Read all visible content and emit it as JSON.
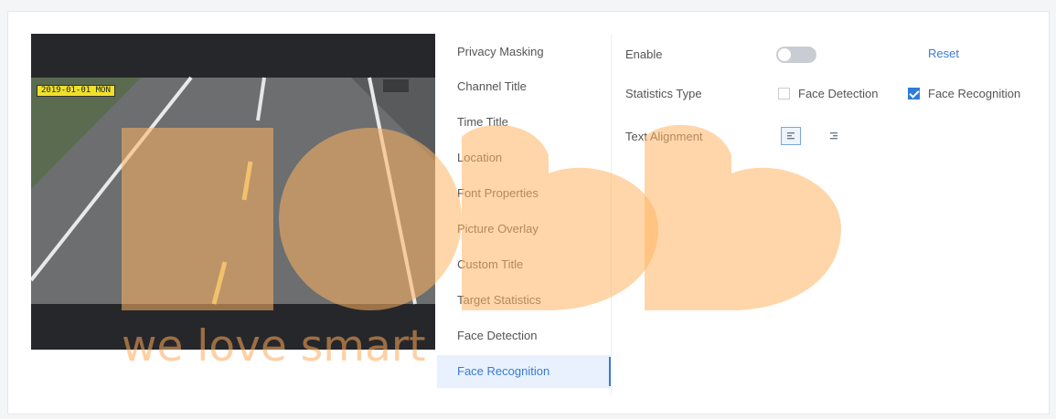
{
  "preview": {
    "osd_label": "2019-01-01 MON"
  },
  "menu": {
    "items": [
      {
        "label": "Privacy Masking"
      },
      {
        "label": "Channel Title"
      },
      {
        "label": "Time Title"
      },
      {
        "label": "Location"
      },
      {
        "label": "Font Properties"
      },
      {
        "label": "Picture Overlay"
      },
      {
        "label": "Custom Title"
      },
      {
        "label": "Target Statistics"
      },
      {
        "label": "Face Detection"
      },
      {
        "label": "Face Recognition"
      }
    ],
    "active": "Face Recognition"
  },
  "settings": {
    "enable_label": "Enable",
    "enable_state": "off",
    "reset_label": "Reset",
    "statistics_type_label": "Statistics Type",
    "face_detection_label": "Face Detection",
    "face_detection_checked": false,
    "face_recognition_label": "Face Recognition",
    "face_recognition_checked": true,
    "text_alignment_label": "Text Alignment",
    "align_left_icon": "align-left-icon",
    "align_right_icon": "align-right-icon"
  },
  "watermark": {
    "text": "we love smart",
    "color": "#ffb463"
  },
  "colors": {
    "accent": "#3b7bd1",
    "active_bg": "#e8f1fd",
    "toggle_off": "#c9ccd2",
    "osd_label_bg": "#f1e02b"
  }
}
